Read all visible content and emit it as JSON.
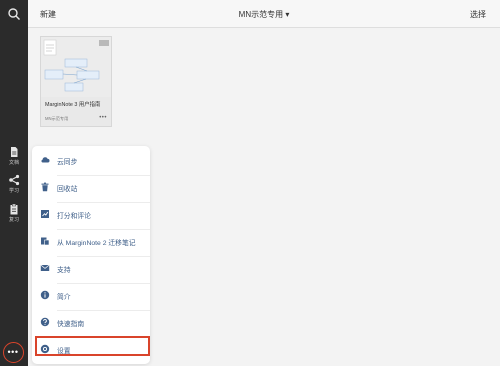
{
  "colors": {
    "accent": "#40608a",
    "highlight": "#d9442b",
    "rail": "#2b2b2b"
  },
  "rail": {
    "search_icon": "search-icon",
    "items": [
      {
        "label": "文档",
        "icon": "document-icon"
      },
      {
        "label": "学习",
        "icon": "mindmap-icon"
      },
      {
        "label": "复习",
        "icon": "clipboard-icon"
      }
    ],
    "more_icon": "more-icon"
  },
  "topbar": {
    "new_label": "新建",
    "title": "MN示范专用 ▾",
    "select_label": "选择"
  },
  "notebook": {
    "title": "MarginNote 3 用户指南",
    "subtitle": "MN示范专用",
    "more": "•••"
  },
  "menu": {
    "items": [
      {
        "label": "云同步",
        "icon": "cloud-icon"
      },
      {
        "label": "回收站",
        "icon": "trash-icon"
      },
      {
        "label": "打分和评论",
        "icon": "rating-icon"
      },
      {
        "label": "从 MarginNote 2 迁移笔记",
        "icon": "import-icon"
      },
      {
        "label": "支持",
        "icon": "mail-icon"
      },
      {
        "label": "简介",
        "icon": "info-icon"
      },
      {
        "label": "快速指南",
        "icon": "help-icon"
      },
      {
        "label": "设置",
        "icon": "settings-icon"
      }
    ]
  }
}
